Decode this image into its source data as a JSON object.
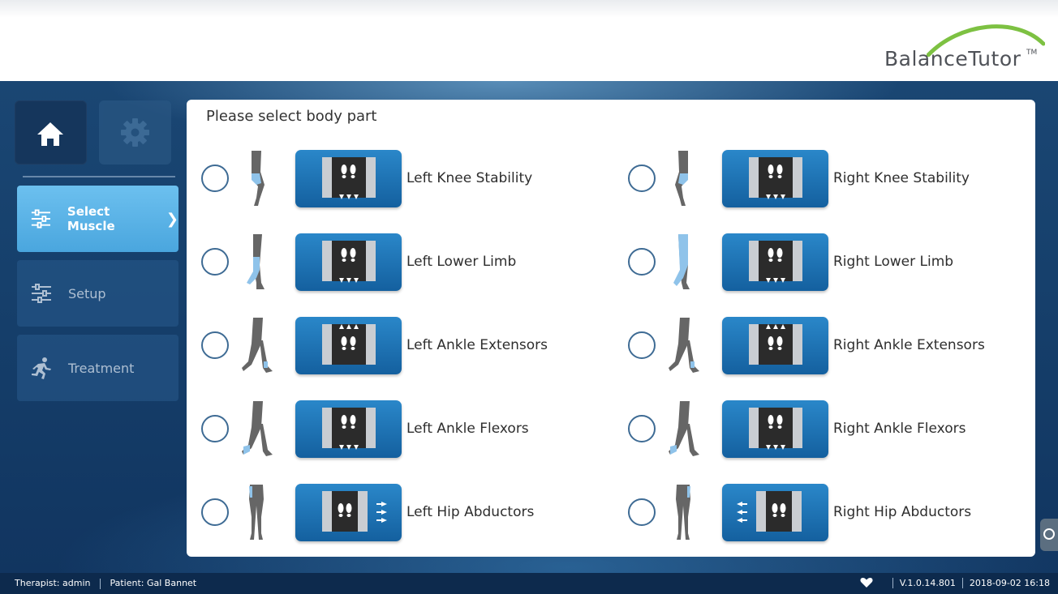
{
  "header": {
    "brand": "BalanceTutor",
    "trademark": "TM",
    "arc_color": "#7dc142"
  },
  "sidebar": {
    "home_icon": "home-icon",
    "settings_icon": "gear-icon",
    "items": [
      {
        "label": "Select Muscle",
        "icon": "sliders-icon",
        "active": true
      },
      {
        "label": "Setup",
        "icon": "sliders-icon",
        "active": false
      },
      {
        "label": "Treatment",
        "icon": "running-person-icon",
        "active": false
      }
    ]
  },
  "panel": {
    "title": "Please select body part",
    "options": [
      {
        "label": "Left Knee Stability"
      },
      {
        "label": "Right Knee Stability"
      },
      {
        "label": "Left Lower Limb"
      },
      {
        "label": "Right Lower Limb"
      },
      {
        "label": "Left Ankle Extensors"
      },
      {
        "label": "Right Ankle Extensors"
      },
      {
        "label": "Left Ankle Flexors"
      },
      {
        "label": "Right Ankle Flexors"
      },
      {
        "label": "Left Hip Abductors"
      },
      {
        "label": "Right Hip Abductors"
      }
    ]
  },
  "footer": {
    "therapist": "Therapist: admin",
    "patient": "Patient: Gal Bannet",
    "version": "V.1.0.14.801",
    "datetime": "2018-09-02 16:18"
  },
  "colors": {
    "accent": "#4aa6de",
    "button": "#1f74b6",
    "highlight": "#8fc3ea"
  }
}
